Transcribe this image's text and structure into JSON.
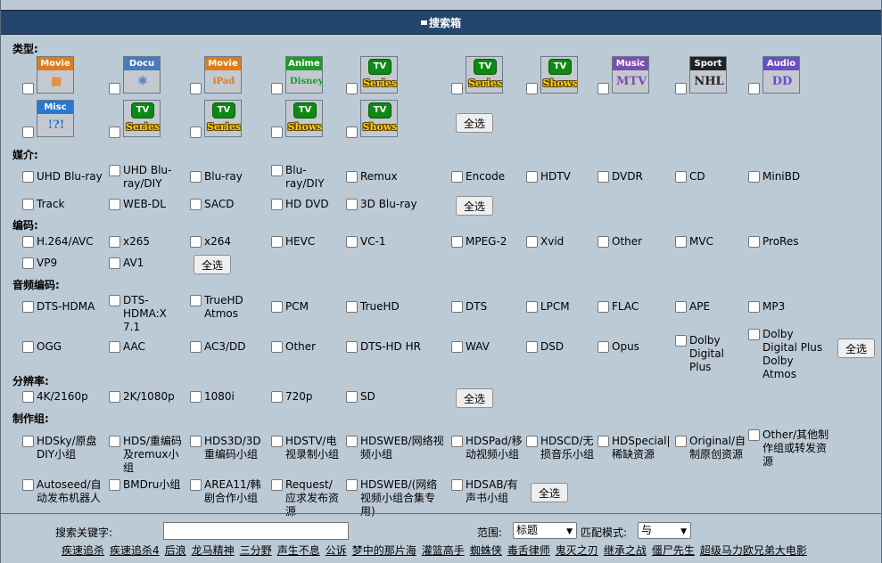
{
  "header": {
    "title": "搜索箱"
  },
  "sections": {
    "type": "类型:",
    "media": "媒介:",
    "codec": "编码:",
    "audio": "音频编码:",
    "resolution": "分辨率:",
    "group": "制作组:"
  },
  "select_all": "全选",
  "type_icons": [
    {
      "tag": "Movie",
      "pic": "▦",
      "color": "#e07b1a"
    },
    {
      "tag": "Docu",
      "pic": "⚛",
      "color": "#4a7ab8"
    },
    {
      "tag": "Movie",
      "pic": "iPad",
      "color": "#e07b1a"
    },
    {
      "tag": "Anime",
      "pic": "Disney",
      "color": "#1e9a2a"
    },
    {
      "tag": "TV",
      "pic": "Series",
      "color": "#0d8a14"
    },
    {
      "tag": "TV",
      "pic": "Series",
      "color": "#0d8a14"
    },
    {
      "tag": "TV",
      "pic": "Shows",
      "color": "#0d8a14"
    },
    {
      "tag": "Music",
      "pic": "MTV",
      "color": "#7a4fb0"
    },
    {
      "tag": "Sport",
      "pic": "NHL",
      "color": "#222222"
    },
    {
      "tag": "Audio",
      "pic": "DD",
      "color": "#6a4fc0"
    },
    {
      "tag": "Misc",
      "pic": "!?!",
      "color": "#2a78d0"
    },
    {
      "tag": "TV",
      "pic": "Series",
      "color": "#0d8a14"
    },
    {
      "tag": "TV",
      "pic": "Series",
      "color": "#0d8a14"
    },
    {
      "tag": "TV",
      "pic": "Shows",
      "color": "#0d8a14"
    },
    {
      "tag": "TV",
      "pic": "Shows",
      "color": "#0d8a14"
    }
  ],
  "media": [
    "UHD Blu-ray",
    "UHD Blu-ray/DIY",
    "Blu-ray",
    "Blu-ray/DIY",
    "Remux",
    "Encode",
    "HDTV",
    "DVDR",
    "CD",
    "MiniBD",
    "Track",
    "WEB-DL",
    "SACD",
    "HD DVD",
    "3D Blu-ray"
  ],
  "codec": [
    "H.264/AVC",
    "x265",
    "x264",
    "HEVC",
    "VC-1",
    "MPEG-2",
    "Xvid",
    "Other",
    "MVC",
    "ProRes",
    "VP9",
    "AV1"
  ],
  "audio": [
    "DTS-HDMA",
    "DTS-HDMA:X 7.1",
    "TrueHD Atmos",
    "PCM",
    "TrueHD",
    "DTS",
    "LPCM",
    "FLAC",
    "APE",
    "MP3",
    "OGG",
    "AAC",
    "AC3/DD",
    "Other",
    "DTS-HD HR",
    "WAV",
    "DSD",
    "Opus",
    "Dolby Digital Plus",
    "Dolby Digital Plus Dolby Atmos"
  ],
  "resolution": [
    "4K/2160p",
    "2K/1080p",
    "1080i",
    "720p",
    "SD"
  ],
  "group": [
    "HDSky/原盘DIY小组",
    "HDS/重编码及remux小组",
    "HDS3D/3D重编码小组",
    "HDSTV/电视录制小组",
    "HDSWEB/网络视频小组",
    "HDSPad/移动视频小组",
    "HDSCD/无损音乐小组",
    "HDSpecial|稀缺资源",
    "Original/自制原创资源",
    "Other/其他制作组或转发资源",
    "Autoseed/自动发布机器人",
    "BMDru小组",
    "AREA11/韩剧合作小组",
    "Request/应求发布资源",
    "HDSWEB/(网络视频小组合集专用)",
    "HDSAB/有声书小组"
  ],
  "footer": {
    "keyword_label": "搜索关键字:",
    "keyword_value": "",
    "scope_label": "范围:",
    "scope_value": "标题",
    "mode_label": "匹配模式:",
    "mode_value": "与",
    "hot_links": [
      "疾速追杀",
      "疾速追杀4",
      "后浪",
      "龙马精神",
      "三分野",
      "声生不息",
      "公诉",
      "梦中的那片海",
      "灌篮高手",
      "蜘蛛侠",
      "毒舌律师",
      "鬼灭之刃",
      "继承之战",
      "僵尸先生",
      "超级马力欧兄弟大电影"
    ]
  }
}
